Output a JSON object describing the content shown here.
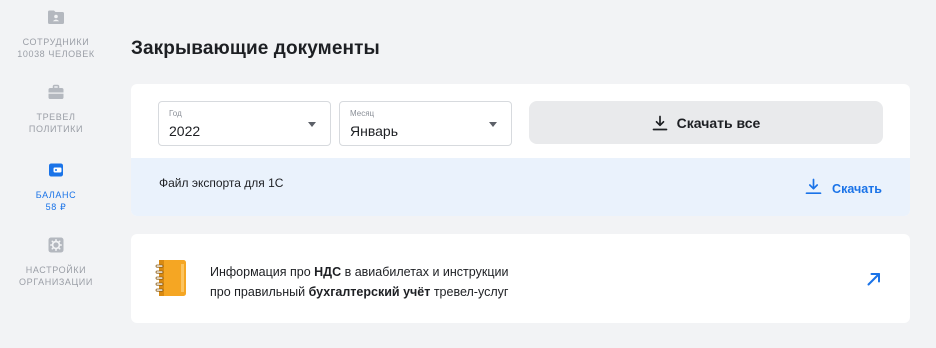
{
  "sidebar": {
    "items": [
      {
        "label_line1": "СОТРУДНИКИ",
        "label_line2": "10038 ЧЕЛОВЕК",
        "icon": "employees-folder-icon",
        "active": false
      },
      {
        "label_line1": "ТРЕВЕЛ",
        "label_line2": "ПОЛИТИКИ",
        "icon": "briefcase-icon",
        "active": false
      },
      {
        "label_line1": "БАЛАНС",
        "label_line2": "58 ₽",
        "icon": "wallet-icon",
        "active": true
      },
      {
        "label_line1": "НАСТРОЙКИ",
        "label_line2": "ОРГАНИЗАЦИИ",
        "icon": "gear-icon",
        "active": false
      }
    ]
  },
  "main": {
    "title": "Закрывающие документы",
    "year_select": {
      "caption": "Год",
      "value": "2022"
    },
    "month_select": {
      "caption": "Месяц",
      "value": "Январь"
    },
    "download_all_label": "Скачать все",
    "export": {
      "label": "Файл экспорта для 1С",
      "link_label": "Скачать"
    },
    "info": {
      "line1_pre": "Информация про ",
      "line1_bold": "НДС",
      "line1_post": " в авиабилетах и инструкции",
      "line2_pre": "про правильный ",
      "line2_bold": "бухгалтерский учёт",
      "line2_post": " тревел-услуг"
    }
  },
  "colors": {
    "accent": "#1a73e8",
    "sidebar_text": "#9a9ea6",
    "export_row_bg": "#eaf2fc",
    "notebook_orange": "#f5a623"
  }
}
